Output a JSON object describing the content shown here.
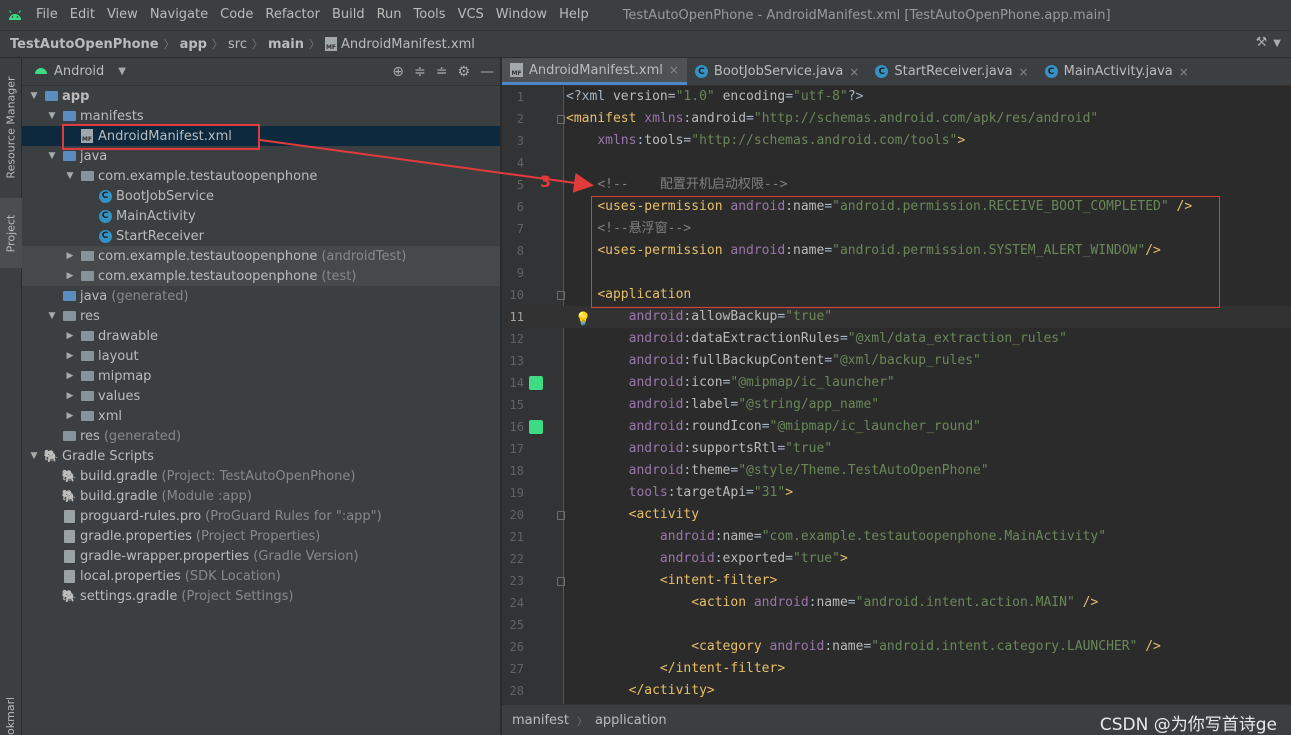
{
  "menubar": {
    "items": [
      "File",
      "Edit",
      "View",
      "Navigate",
      "Code",
      "Refactor",
      "Build",
      "Run",
      "Tools",
      "VCS",
      "Window",
      "Help"
    ],
    "window_title": "TestAutoOpenPhone - AndroidManifest.xml [TestAutoOpenPhone.app.main]"
  },
  "breadcrumb": {
    "items": [
      "TestAutoOpenPhone",
      "app",
      "src",
      "main",
      "AndroidManifest.xml"
    ]
  },
  "side_tabs": {
    "resource_manager": "Resource Manager",
    "project": "Project",
    "bookmarks": "Bookmarks"
  },
  "project_panel": {
    "view_mode": "Android",
    "tree": [
      {
        "label": "app",
        "dim": ""
      },
      {
        "label": "manifests",
        "dim": ""
      },
      {
        "label": "AndroidManifest.xml",
        "dim": ""
      },
      {
        "label": "java",
        "dim": ""
      },
      {
        "label": "com.example.testautoopenphone",
        "dim": ""
      },
      {
        "label": "BootJobService",
        "dim": ""
      },
      {
        "label": "MainActivity",
        "dim": ""
      },
      {
        "label": "StartReceiver",
        "dim": ""
      },
      {
        "label": "com.example.testautoopenphone",
        "dim": "(androidTest)"
      },
      {
        "label": "com.example.testautoopenphone",
        "dim": "(test)"
      },
      {
        "label": "java",
        "dim": "(generated)"
      },
      {
        "label": "res",
        "dim": ""
      },
      {
        "label": "drawable",
        "dim": ""
      },
      {
        "label": "layout",
        "dim": ""
      },
      {
        "label": "mipmap",
        "dim": ""
      },
      {
        "label": "values",
        "dim": ""
      },
      {
        "label": "xml",
        "dim": ""
      },
      {
        "label": "res",
        "dim": "(generated)"
      },
      {
        "label": "Gradle Scripts",
        "dim": ""
      },
      {
        "label": "build.gradle",
        "dim": "(Project: TestAutoOpenPhone)"
      },
      {
        "label": "build.gradle",
        "dim": "(Module :app)"
      },
      {
        "label": "proguard-rules.pro",
        "dim": "(ProGuard Rules for \":app\")"
      },
      {
        "label": "gradle.properties",
        "dim": "(Project Properties)"
      },
      {
        "label": "gradle-wrapper.properties",
        "dim": "(Gradle Version)"
      },
      {
        "label": "local.properties",
        "dim": "(SDK Location)"
      },
      {
        "label": "settings.gradle",
        "dim": "(Project Settings)"
      }
    ]
  },
  "editor": {
    "tabs": [
      {
        "label": "AndroidManifest.xml",
        "active": true
      },
      {
        "label": "BootJobService.java",
        "active": false
      },
      {
        "label": "StartReceiver.java",
        "active": false
      },
      {
        "label": "MainActivity.java",
        "active": false
      }
    ],
    "current_line": 11,
    "lines": [
      "<?xml version=\"1.0\" encoding=\"utf-8\"?>",
      "<manifest xmlns:android=\"http://schemas.android.com/apk/res/android\"",
      "    xmlns:tools=\"http://schemas.android.com/tools\">",
      "",
      "    <!--    配置开机启动权限-->",
      "    <uses-permission android:name=\"android.permission.RECEIVE_BOOT_COMPLETED\" />",
      "    <!--悬浮窗-->",
      "    <uses-permission android:name=\"android.permission.SYSTEM_ALERT_WINDOW\"/>",
      "",
      "    <application",
      "        android:allowBackup=\"true\"",
      "        android:dataExtractionRules=\"@xml/data_extraction_rules\"",
      "        android:fullBackupContent=\"@xml/backup_rules\"",
      "        android:icon=\"@mipmap/ic_launcher\"",
      "        android:label=\"@string/app_name\"",
      "        android:roundIcon=\"@mipmap/ic_launcher_round\"",
      "        android:supportsRtl=\"true\"",
      "        android:theme=\"@style/Theme.TestAutoOpenPhone\"",
      "        tools:targetApi=\"31\">",
      "        <activity",
      "            android:name=\"com.example.testautoopenphone.MainActivity\"",
      "            android:exported=\"true\">",
      "            <intent-filter>",
      "                <action android:name=\"android.intent.action.MAIN\" />",
      "",
      "                <category android:name=\"android.intent.category.LAUNCHER\" />",
      "            </intent-filter>",
      "        </activity>"
    ],
    "annotation_number": "3",
    "code_breadcrumb": [
      "manifest",
      "application"
    ]
  },
  "watermark": "CSDN @为你写首诗ge",
  "colors": {
    "annotation": "#e23b3b",
    "tag": "#e8bf6a",
    "namespace": "#9876aa",
    "value": "#6a8759",
    "comment": "#808080"
  }
}
